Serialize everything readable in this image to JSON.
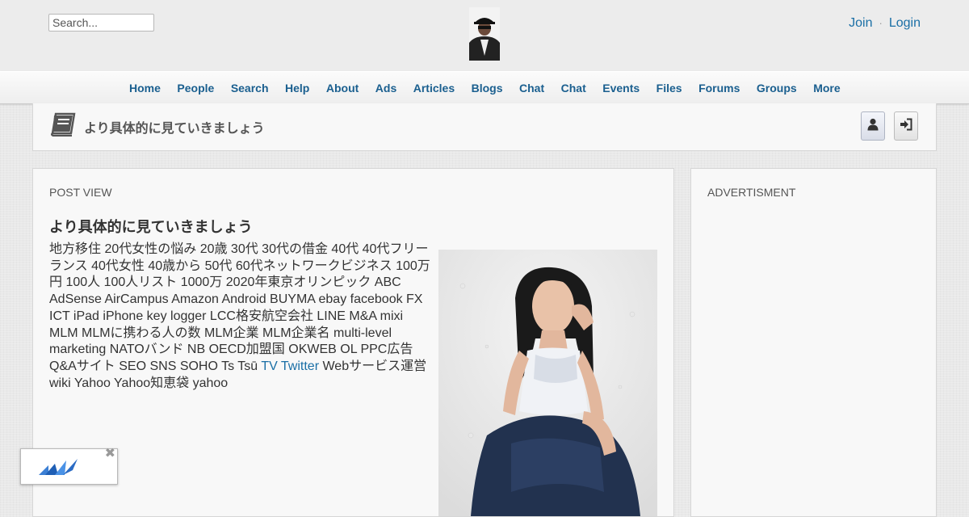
{
  "header": {
    "search_placeholder": "Search...",
    "auth": {
      "join": "Join",
      "separator": "·",
      "login": "Login"
    }
  },
  "nav": {
    "items": [
      "Home",
      "People",
      "Search",
      "Help",
      "About",
      "Ads",
      "Articles",
      "Blogs",
      "Chat",
      "Chat",
      "Events",
      "Files",
      "Forums",
      "Groups",
      "More"
    ]
  },
  "page_head": {
    "icon": "book-icon",
    "title": "より具体的に見ていきましょう",
    "user_button_icon": "user-icon",
    "login_button_icon": "sign-in-icon"
  },
  "post": {
    "section_label": "POST VIEW",
    "title": "より具体的に見ていきましょう",
    "body_before_link": "地方移住 20代女性の悩み 20歳 30代 30代の借金 40代 40代フリーランス 40代女性 40歳から 50代 60代ネットワークビジネス 100万円 100人 100人リスト 1000万 2020年東京オリンピック ABC AdSense AirCampus Amazon Android BUYMA ebay facebook FX ICT iPad iPhone key logger LCC格安航空会社 LINE M&A mixi MLM MLMに携わる人の数 MLM企業 MLM企業名 multi-level marketing NATOバンド NB OECD加盟国 OKWEB OL PPC広告 Q&Aサイト SEO SNS SOHO Ts Tsū ",
    "link_text": "TV Twitter",
    "body_after_link": " Webサービス運営 wiki Yahoo Yahoo知恵袋 yahoo",
    "image_icon": "photo-woman"
  },
  "sidebar": {
    "label": "ADVERTISMENT"
  },
  "float_ad": {
    "close": "✖",
    "logo_icon": "brand-logo-icon"
  },
  "colors": {
    "link": "#1a6fa6",
    "nav_link": "#1a5f8f",
    "panel_bg": "#f8f8f8",
    "page_bg": "#e9e9e9"
  }
}
